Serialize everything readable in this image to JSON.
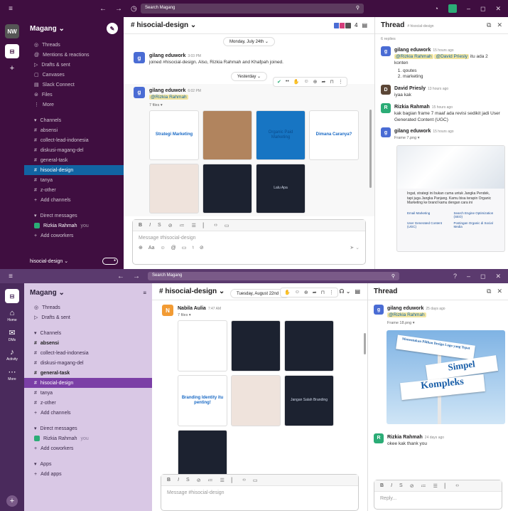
{
  "w1": {
    "search": "Search Magang",
    "workspace": {
      "initials": "NW",
      "name": "Magang"
    },
    "nav": [
      {
        "icon": "threads-icon",
        "glyph": "◎",
        "label": "Threads"
      },
      {
        "icon": "at-icon",
        "glyph": "@",
        "label": "Mentions & reactions"
      },
      {
        "icon": "send-icon",
        "glyph": "▷",
        "label": "Drafts & sent"
      },
      {
        "icon": "canvas-icon",
        "glyph": "▢",
        "label": "Canvases"
      },
      {
        "icon": "building-icon",
        "glyph": "▤",
        "label": "Slack Connect"
      },
      {
        "icon": "files-icon",
        "glyph": "⊜",
        "label": "Files"
      },
      {
        "icon": "more-icon",
        "glyph": "⋮",
        "label": "More"
      }
    ],
    "channels_label": "Channels",
    "channels": [
      {
        "name": "absensi",
        "active": false
      },
      {
        "name": "collect-lead-indonesia",
        "active": false
      },
      {
        "name": "diskusi-magang-del",
        "active": false
      },
      {
        "name": "general-task",
        "active": false
      },
      {
        "name": "hisocial-design",
        "active": true
      },
      {
        "name": "tanya",
        "active": false
      },
      {
        "name": "z-other",
        "active": false
      }
    ],
    "add_channels": "Add channels",
    "dm_label": "Direct messages",
    "dm_user": "Rizkia Rahmah",
    "dm_you": "you",
    "add_coworkers": "Add coworkers",
    "footer_channel": "hisocial-design",
    "channel_title": "# hisocial-design",
    "member_count": "4",
    "date1": "Monday, July 24th",
    "join_msg": {
      "name": "gilang eduwork",
      "time": "3:03 PM",
      "text": "joined #hisocial-design. Also, Rizkia Rahmah and Khafpah joined."
    },
    "date2": "Yesterday",
    "post": {
      "name": "gilang eduwork",
      "time": "6:02 PM",
      "mention": "@Rizkia Rahmah",
      "files": "7 files"
    },
    "thumbs": [
      {
        "text": "Strategi Marketing",
        "style": "t-white"
      },
      {
        "text": "",
        "style": "t-brown"
      },
      {
        "text": "Organic Paid Marketing",
        "style": "t-blue"
      },
      {
        "text": "Dimana Caranya?",
        "style": "t-white"
      },
      {
        "text": "",
        "style": "t-pink"
      },
      {
        "text": "",
        "style": "t-dark"
      },
      {
        "text": "Lalu Apa",
        "style": "t-dark"
      }
    ],
    "composer_placeholder": "Message #hisocial-design",
    "thread": {
      "title": "Thread",
      "sub": "# hisocial-design",
      "replies": "6 replies",
      "m1": {
        "name": "gilang eduwork",
        "time": "15 hours ago",
        "mention1": "@Rizkia Rahmah",
        "mention2": "@David Priesly",
        "text": "itu ada 2 konten",
        "items": [
          "qoutes",
          "marketing"
        ]
      },
      "m2": {
        "name": "David Priesly",
        "time": "13 hours ago",
        "text": "iyaa kak"
      },
      "m3": {
        "name": "Rizkia Rahmah",
        "time": "15 hours ago",
        "text": "kak bagian frame 7 maaf ada revisi sedikit jadi User Generated Content (UGC)"
      },
      "m4": {
        "name": "gilang eduwork",
        "time": "15 hours ago",
        "file": "Frame 7.png"
      },
      "image_text": "Ingat, strategi ini bukan cuma untuk Jangka Pendek, tapi juga Jangka Panjang. Kamu bisa terapin Organic Marketing ke brand kamu dengan cara ini",
      "image_items": [
        "Email Marketing",
        "Search Engine Optimization (SEO)",
        "User Generated Content (UGC)",
        "Postingan Organic di Social Media"
      ]
    }
  },
  "w2": {
    "search": "Search Magang",
    "workspace_name": "Magang",
    "rail": [
      "Home",
      "DMs",
      "Activity",
      "More"
    ],
    "nav": [
      {
        "icon": "threads-icon",
        "glyph": "◎",
        "label": "Threads"
      },
      {
        "icon": "send-icon",
        "glyph": "▷",
        "label": "Drafts & sent"
      }
    ],
    "channels_label": "Channels",
    "channels": [
      {
        "name": "absensi",
        "active": false,
        "bold": true
      },
      {
        "name": "collect-lead-indonesia",
        "active": false,
        "bold": false
      },
      {
        "name": "diskusi-magang-del",
        "active": false,
        "bold": false
      },
      {
        "name": "general-task",
        "active": false,
        "bold": true
      },
      {
        "name": "hisocial-design",
        "active": true,
        "bold": false
      },
      {
        "name": "tanya",
        "active": false,
        "bold": false
      },
      {
        "name": "z-other",
        "active": false,
        "bold": false
      }
    ],
    "add_channels": "Add channels",
    "dm_label": "Direct messages",
    "dm_user": "Rizkia Rahmah",
    "dm_you": "you",
    "add_coworkers": "Add coworkers",
    "apps_label": "Apps",
    "add_apps": "Add apps",
    "channel_title": "# hisocial-design",
    "member_count": "10",
    "date": "Tuesday, August 22nd",
    "post": {
      "name": "Nabila Aulia",
      "initial": "N",
      "time": "7:47 AM",
      "files": "7 files"
    },
    "thumbs": [
      {
        "text": "",
        "style": "t-white"
      },
      {
        "text": "",
        "style": "t-dark"
      },
      {
        "text": "",
        "style": "t-dark"
      },
      {
        "text": "Branding Identity itu penting!",
        "style": "t-white"
      },
      {
        "text": "",
        "style": "t-pink"
      },
      {
        "text": "Jangan Salah Branding",
        "style": "t-dark"
      },
      {
        "text": "",
        "style": "t-dark"
      }
    ],
    "composer_placeholder": "Message #hisocial-design",
    "thread": {
      "title": "Thread",
      "m1": {
        "name": "gilang eduwork",
        "time": "25 days ago",
        "mention": "@Rizkia Rahmah",
        "file": "Frame 18.png"
      },
      "signs": [
        "Menentukan Pilihan Design Logo yang Tepat",
        "Simpel",
        "Kompleks"
      ],
      "m2": {
        "name": "Rizkia Rahmah",
        "time": "24 days ago",
        "text": "okee kak thank you"
      },
      "reply_placeholder": "Reply..."
    }
  }
}
